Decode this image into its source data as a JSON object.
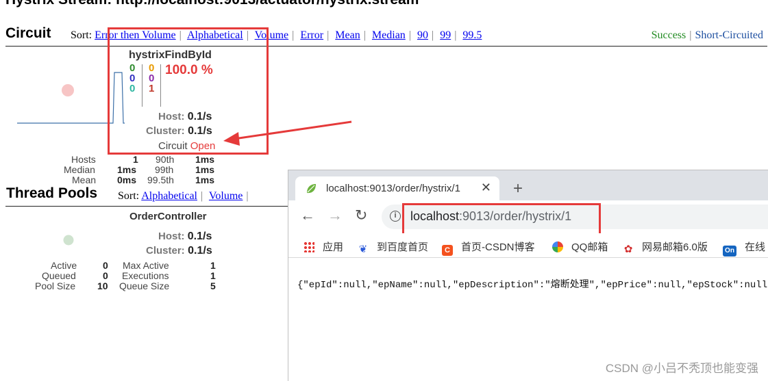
{
  "dashboard": {
    "stream_title": "Hystrix Stream: http://localhost:9013/actuator/hystrix.stream",
    "circuit_heading": "Circuit",
    "sort_label": "Sort:",
    "sort_options": [
      "Error then Volume",
      "Alphabetical",
      "Volume",
      "Error",
      "Mean",
      "Median",
      "90",
      "99",
      "99.5"
    ],
    "legend": {
      "success": "Success",
      "short_circuited": "Short-Circuited"
    },
    "circuit": {
      "name": "hystrixFindById",
      "counts_left": [
        "0",
        "0",
        "0"
      ],
      "counts_mid": [
        "0",
        "0",
        "1"
      ],
      "error_rate": "100.0 %",
      "host_label": "Host:",
      "host_value": "0.1/s",
      "cluster_label": "Cluster:",
      "cluster_value": "0.1/s",
      "status_label": "Circuit",
      "status_value": "Open",
      "latency": {
        "hosts_label": "Hosts",
        "hosts_value": "1",
        "p90_label": "90th",
        "p90_value": "1ms",
        "median_label": "Median",
        "median_value": "1ms",
        "p99_label": "99th",
        "p99_value": "1ms",
        "mean_label": "Mean",
        "mean_value": "0ms",
        "p995_label": "99.5th",
        "p995_value": "1ms"
      }
    },
    "thread_pools": {
      "heading": "Thread Pools",
      "sort_label": "Sort:",
      "sort_options": [
        "Alphabetical",
        "Volume"
      ],
      "pool": {
        "name": "OrderController",
        "host_label": "Host:",
        "host_value": "0.1/s",
        "cluster_label": "Cluster:",
        "cluster_value": "0.1/s",
        "active_label": "Active",
        "active_value": "0",
        "queued_label": "Queued",
        "queued_value": "0",
        "pool_size_label": "Pool Size",
        "pool_size_value": "10",
        "max_active_label": "Max Active",
        "max_active_value": "1",
        "executions_label": "Executions",
        "executions_value": "1",
        "queue_size_label": "Queue Size",
        "queue_size_value": "5"
      }
    },
    "colors": {
      "success": "#228B22",
      "error": "#e53a3a",
      "highlight": "#e53a3a"
    }
  },
  "browser": {
    "tab_title": "localhost:9013/order/hystrix/1",
    "new_tab_icon": "+",
    "url_host": "localhost",
    "url_path": ":9013/order/hystrix/1",
    "bookmarks": [
      "应用",
      "到百度首页",
      "首页-CSDN博客",
      "QQ邮箱",
      "网易邮箱6.0版",
      "在线"
    ],
    "response_body": "{\"epId\":null,\"epName\":null,\"epDescription\":\"熔断处理\",\"epPrice\":null,\"epStock\":null,\"ep"
  },
  "watermark": "CSDN @小吕不秃顶也能变强"
}
